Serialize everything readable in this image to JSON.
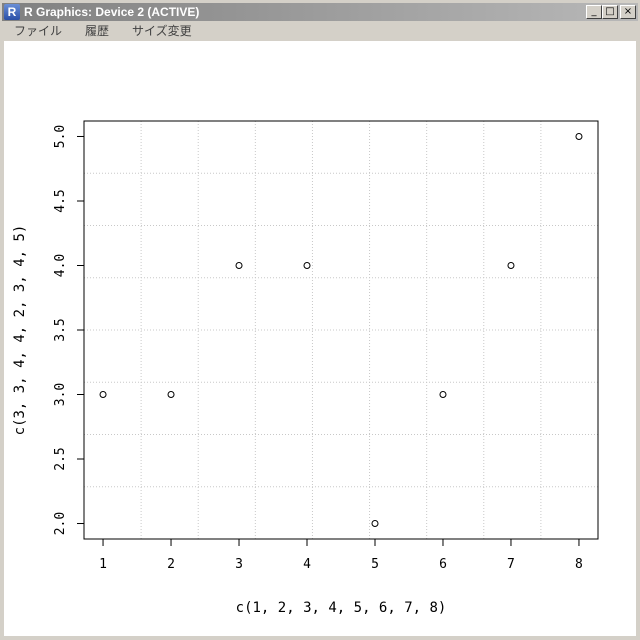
{
  "window": {
    "title": "R Graphics: Device 2 (ACTIVE)",
    "app_icon_letter": "R",
    "minimize_glyph": "_",
    "maximize_glyph": "□",
    "close_glyph": "×"
  },
  "menu": {
    "items": [
      "ファイル",
      "履歴",
      "サイズ変更"
    ]
  },
  "chart_data": {
    "type": "scatter",
    "x": [
      1,
      2,
      3,
      4,
      5,
      6,
      7,
      8
    ],
    "y": [
      3,
      3,
      4,
      4,
      2,
      3,
      4,
      5
    ],
    "xlabel": "c(1, 2, 3, 4, 5, 6, 7, 8)",
    "ylabel": "c(3, 3, 4, 4, 2, 3, 4, 5)",
    "xticks": [
      1,
      2,
      3,
      4,
      5,
      6,
      7,
      8
    ],
    "yticks": [
      "2.0",
      "2.5",
      "3.0",
      "3.5",
      "4.0",
      "4.5",
      "5.0"
    ],
    "xlim": [
      0.72,
      8.28
    ],
    "ylim": [
      1.88,
      5.12
    ],
    "grid": true,
    "marker": "open-circle"
  }
}
